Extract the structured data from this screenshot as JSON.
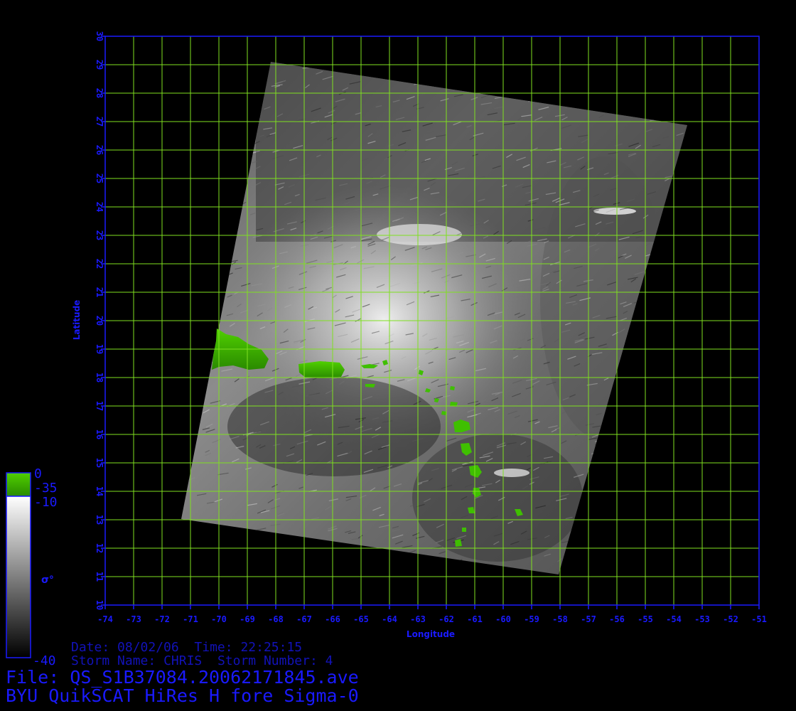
{
  "map": {
    "lon_ticks": [
      "-74",
      "-73",
      "-72",
      "-71",
      "-70",
      "-69",
      "-68",
      "-67",
      "-66",
      "-65",
      "-64",
      "-63",
      "-62",
      "-61",
      "-60",
      "-59",
      "-58",
      "-57",
      "-56",
      "-55",
      "-54",
      "-53",
      "-52",
      "-51"
    ],
    "lat_ticks": [
      "10",
      "11",
      "12",
      "13",
      "14",
      "15",
      "16",
      "17",
      "18",
      "19",
      "20",
      "21",
      "22",
      "23",
      "24",
      "25",
      "26",
      "27",
      "28",
      "29",
      "30"
    ],
    "xlabel": "Longitude",
    "ylabel": "Latitude",
    "grid_color": "#7fe020",
    "axis_color": "#1a1aff",
    "land_color": "#3fbf00"
  },
  "colorbar": {
    "tick_top": "0",
    "tick_land": "-35",
    "tick_max": "-10",
    "tick_min": "-40",
    "symbol": "σ°"
  },
  "footer": {
    "date_label": "Date:",
    "date": "08/02/06",
    "time_label": "Time:",
    "time": "22:25:15",
    "storm_name_label": "Storm Name:",
    "storm_name": "CHRIS",
    "storm_number_label": "Storm Number:",
    "storm_number": "4",
    "file_label": "File:",
    "file": "QS_S1B37084.20062171845.ave",
    "product": "BYU QuikSCAT HiRes H fore Sigma-0"
  }
}
